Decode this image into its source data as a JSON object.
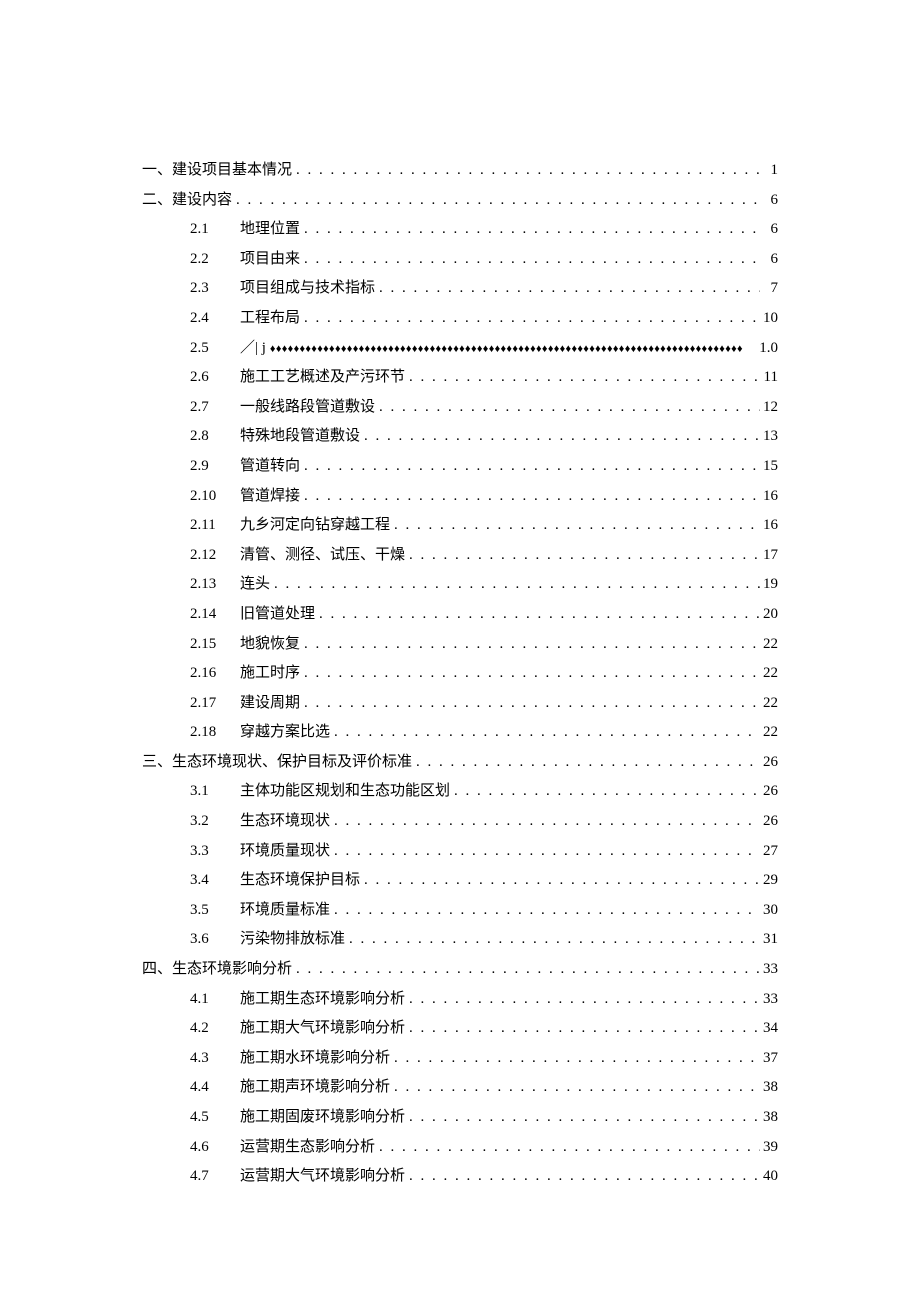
{
  "toc": [
    {
      "level": 1,
      "prefix": "一、",
      "title": "建设项目基本情况",
      "page": "1",
      "leader": "dots"
    },
    {
      "level": 1,
      "prefix": "二、",
      "title": "建设内容",
      "page": "6",
      "leader": "dots"
    },
    {
      "level": 2,
      "num": "2.1",
      "title": "地理位置",
      "page": "6",
      "leader": "dots"
    },
    {
      "level": 2,
      "num": "2.2",
      "title": "项目由来",
      "page": "6",
      "leader": "dots"
    },
    {
      "level": 2,
      "num": "2.3",
      "title": "项目组成与技术指标",
      "page": "7",
      "leader": "dots"
    },
    {
      "level": 2,
      "num": "2.4",
      "title": "工程布局",
      "page": "10",
      "leader": "dots"
    },
    {
      "level": 2,
      "num": "2.5",
      "title": "／| j",
      "page": "1.0",
      "leader": "diams"
    },
    {
      "level": 2,
      "num": "2.6",
      "title": "施工工艺概述及产污环节",
      "page": "11",
      "leader": "dots"
    },
    {
      "level": 2,
      "num": "2.7",
      "title": "一般线路段管道敷设",
      "page": "12",
      "leader": "dots"
    },
    {
      "level": 2,
      "num": "2.8",
      "title": "特殊地段管道敷设",
      "page": "13",
      "leader": "dots"
    },
    {
      "level": 2,
      "num": "2.9",
      "title": "管道转向",
      "page": "15",
      "leader": "dots"
    },
    {
      "level": 2,
      "num": "2.10",
      "title": "管道焊接",
      "page": "16",
      "leader": "dots"
    },
    {
      "level": 2,
      "num": "2.11",
      "title": "九乡河定向钻穿越工程",
      "page": "16",
      "leader": "dots"
    },
    {
      "level": 2,
      "num": "2.12",
      "title": "清管、测径、试压、干燥",
      "page": "17",
      "leader": "dots"
    },
    {
      "level": 2,
      "num": "2.13",
      "title": "连头",
      "page": "19",
      "leader": "dots"
    },
    {
      "level": 2,
      "num": "2.14",
      "title": "旧管道处理",
      "page": "20",
      "leader": "dots"
    },
    {
      "level": 2,
      "num": "2.15",
      "title": "地貌恢复",
      "page": "22",
      "leader": "dots"
    },
    {
      "level": 2,
      "num": "2.16",
      "title": "施工时序",
      "page": "22",
      "leader": "dots"
    },
    {
      "level": 2,
      "num": "2.17",
      "title": "建设周期",
      "page": "22",
      "leader": "dots"
    },
    {
      "level": 2,
      "num": "2.18",
      "title": "穿越方案比选",
      "page": "22",
      "leader": "dots"
    },
    {
      "level": 1,
      "prefix": "三、",
      "title": "生态环境现状、保护目标及评价标准",
      "page": "26",
      "leader": "dots"
    },
    {
      "level": 2,
      "num": "3.1",
      "title": "主体功能区规划和生态功能区划",
      "page": "26",
      "leader": "dots"
    },
    {
      "level": 2,
      "num": "3.2",
      "title": "生态环境现状",
      "page": "26",
      "leader": "dots"
    },
    {
      "level": 2,
      "num": "3.3",
      "title": "环境质量现状",
      "page": "27",
      "leader": "dots"
    },
    {
      "level": 2,
      "num": "3.4",
      "title": "生态环境保护目标",
      "page": "29",
      "leader": "dots"
    },
    {
      "level": 2,
      "num": "3.5",
      "title": "环境质量标准",
      "page": "30",
      "leader": "dots"
    },
    {
      "level": 2,
      "num": "3.6",
      "title": "污染物排放标准",
      "page": "31",
      "leader": "dots"
    },
    {
      "level": 1,
      "prefix": "四、",
      "title": "生态环境影响分析",
      "page": "33",
      "leader": "dots"
    },
    {
      "level": 2,
      "num": "4.1",
      "title": "施工期生态环境影响分析",
      "page": "33",
      "leader": "dots"
    },
    {
      "level": 2,
      "num": "4.2",
      "title": "施工期大气环境影响分析",
      "page": "34",
      "leader": "dots"
    },
    {
      "level": 2,
      "num": "4.3",
      "title": "施工期水环境影响分析",
      "page": "37",
      "leader": "dots"
    },
    {
      "level": 2,
      "num": "4.4",
      "title": "施工期声环境影响分析",
      "page": "38",
      "leader": "dots"
    },
    {
      "level": 2,
      "num": "4.5",
      "title": "施工期固废环境影响分析",
      "page": "38",
      "leader": "dots"
    },
    {
      "level": 2,
      "num": "4.6",
      "title": "运营期生态影响分析",
      "page": "39",
      "leader": "dots"
    },
    {
      "level": 2,
      "num": "4.7",
      "title": "运营期大气环境影响分析",
      "page": "40",
      "leader": "dots"
    }
  ]
}
